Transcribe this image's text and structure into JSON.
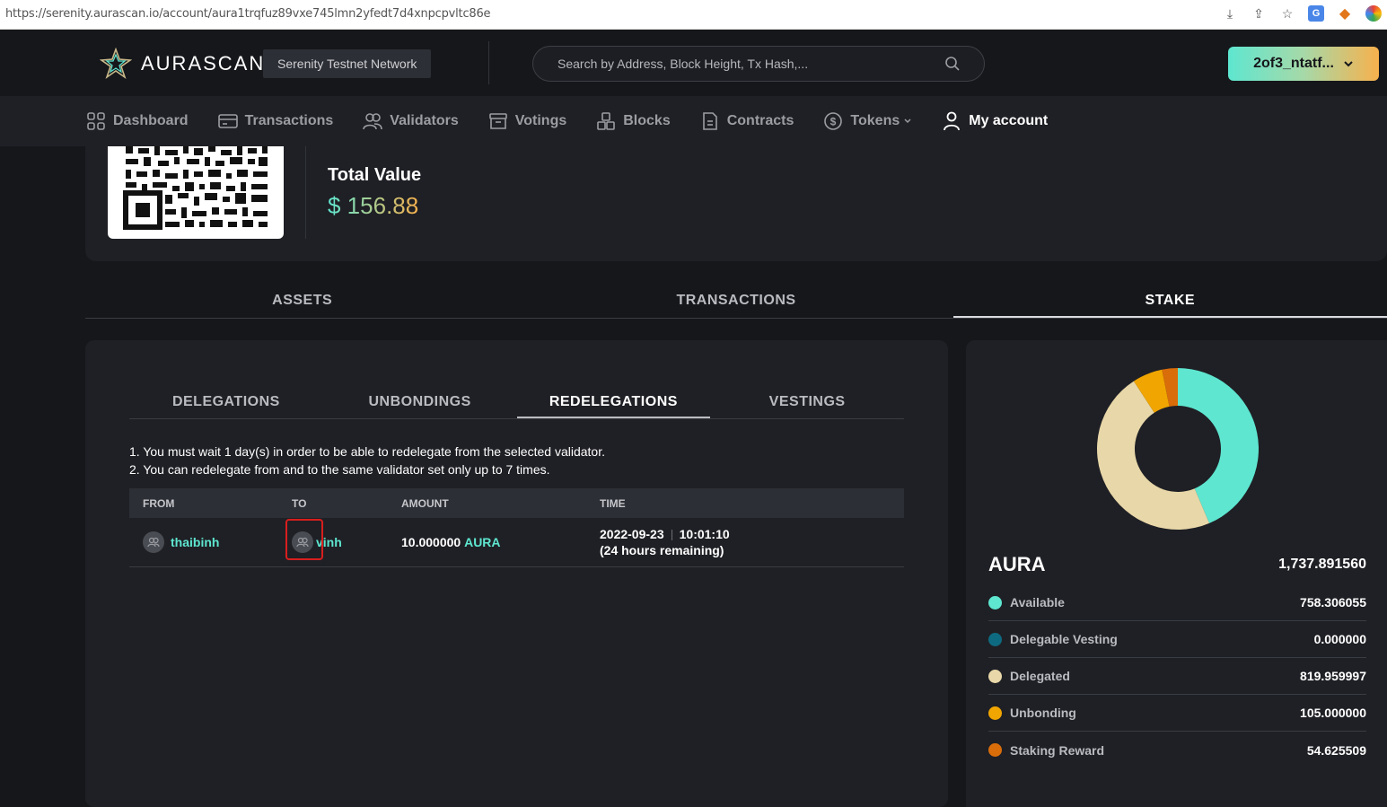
{
  "browser": {
    "url": "https://serenity.aurascan.io/account/aura1trqfuz89vxe745lmn2yfedt7d4xnpcpvltc86e"
  },
  "header": {
    "logo_text": "AURASCAN",
    "network": "Serenity Testnet Network",
    "search_placeholder": "Search by Address, Block Height, Tx Hash,...",
    "wallet_label": "2of3_ntatf..."
  },
  "nav": {
    "items": [
      {
        "label": "Dashboard",
        "icon": "dashboard-icon"
      },
      {
        "label": "Transactions",
        "icon": "transactions-icon"
      },
      {
        "label": "Validators",
        "icon": "validators-icon"
      },
      {
        "label": "Votings",
        "icon": "votings-icon"
      },
      {
        "label": "Blocks",
        "icon": "blocks-icon"
      },
      {
        "label": "Contracts",
        "icon": "contracts-icon"
      },
      {
        "label": "Tokens",
        "icon": "tokens-icon"
      },
      {
        "label": "My account",
        "icon": "user-icon"
      }
    ]
  },
  "account": {
    "total_label": "Total Value",
    "total_value": "$ 156.88"
  },
  "main_tabs": [
    "ASSETS",
    "TRANSACTIONS",
    "STAKE"
  ],
  "stake": {
    "sub_tabs": [
      "DELEGATIONS",
      "UNBONDINGS",
      "REDELEGATIONS",
      "VESTINGS"
    ],
    "notes": [
      "1. You must wait 1 day(s) in order to be able to redelegate from the selected validator.",
      "2. You can redelegate from and to the same validator set only up to 7 times."
    ],
    "table": {
      "headers": [
        "FROM",
        "TO",
        "AMOUNT",
        "TIME"
      ],
      "rows": [
        {
          "from": "thaibinh",
          "to": "vinh",
          "amount": "10.000000",
          "denom": "AURA",
          "date": "2022-09-23",
          "time": "10:01:10",
          "remaining": "(24 hours remaining)"
        }
      ]
    }
  },
  "summary": {
    "token": "AURA",
    "total": "1,737.891560",
    "rows": [
      {
        "label": "Available",
        "value": "758.306055",
        "color": "#5ee6d0"
      },
      {
        "label": "Delegable Vesting",
        "value": "0.000000",
        "color": "#0e6a80"
      },
      {
        "label": "Delegated",
        "value": "819.959997",
        "color": "#e8d7a8"
      },
      {
        "label": "Unbonding",
        "value": "105.000000",
        "color": "#f0a500"
      },
      {
        "label": "Staking Reward",
        "value": "54.625509",
        "color": "#d96d0a"
      }
    ]
  }
}
